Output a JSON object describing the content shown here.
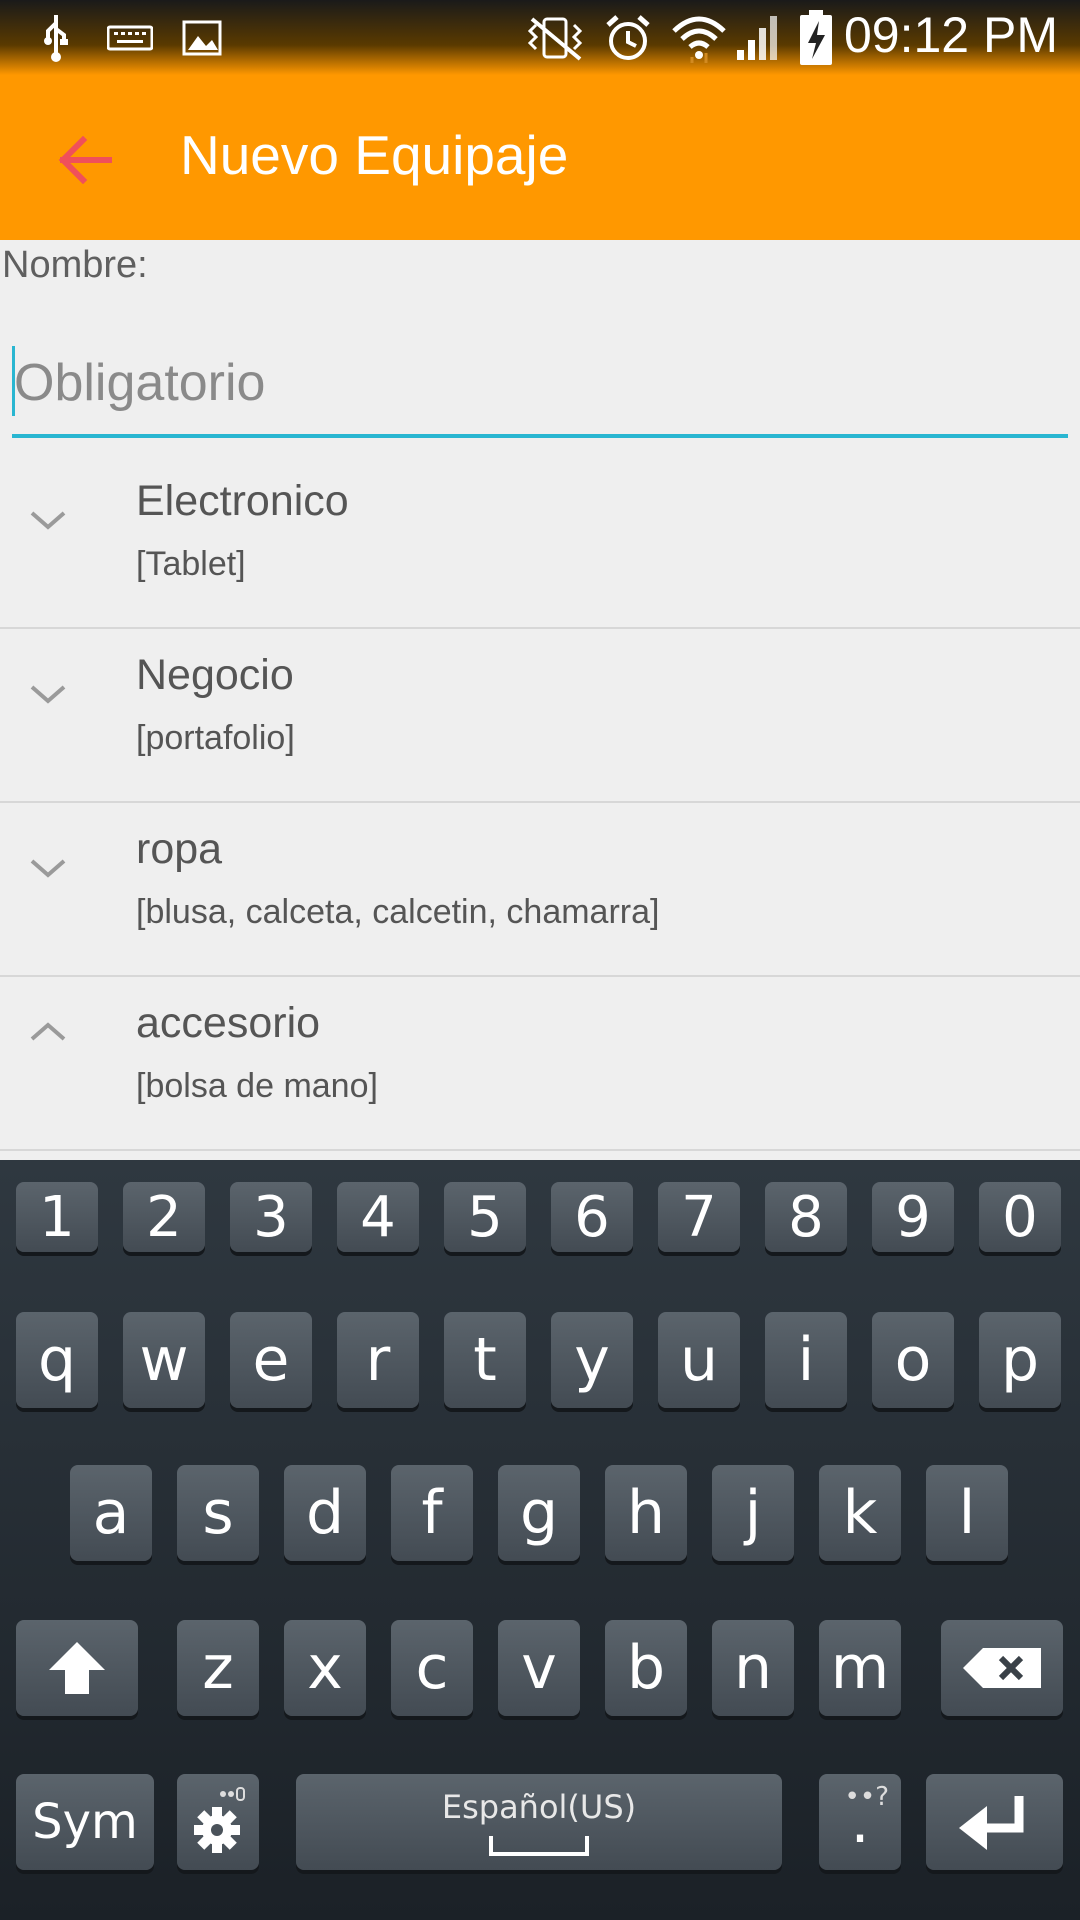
{
  "status_bar": {
    "time": "09:12 PM",
    "icons_left": [
      "usb-icon",
      "keyboard-icon",
      "image-icon"
    ],
    "icons_right": [
      "vibrate-icon",
      "alarm-icon",
      "wifi-icon",
      "signal-icon",
      "battery-charging-icon"
    ]
  },
  "app_bar": {
    "title": "Nuevo Equipaje",
    "back_icon": "arrow-left-icon",
    "back_color": "#f0505a",
    "background": "#ff9800"
  },
  "form": {
    "name_label": "Nombre:",
    "name_placeholder": "Obligatorio",
    "name_value": "",
    "accent": "#29b6d1"
  },
  "categories": [
    {
      "title": "Electronico",
      "items": "[Tablet]",
      "expanded": false
    },
    {
      "title": "Negocio",
      "items": "[portafolio]",
      "expanded": false
    },
    {
      "title": "ropa",
      "items": "[blusa, calceta, calcetin, chamarra]",
      "expanded": false
    },
    {
      "title": "accesorio",
      "items": "[bolsa de mano]",
      "expanded": true
    }
  ],
  "keyboard": {
    "row1": [
      "1",
      "2",
      "3",
      "4",
      "5",
      "6",
      "7",
      "8",
      "9",
      "0"
    ],
    "row2": [
      "q",
      "w",
      "e",
      "r",
      "t",
      "y",
      "u",
      "i",
      "o",
      "p"
    ],
    "row3": [
      "a",
      "s",
      "d",
      "f",
      "g",
      "h",
      "j",
      "k",
      "l"
    ],
    "row4": [
      "z",
      "x",
      "c",
      "v",
      "b",
      "n",
      "m"
    ],
    "sym": "Sym",
    "space": "Español(US)",
    "period": "."
  }
}
